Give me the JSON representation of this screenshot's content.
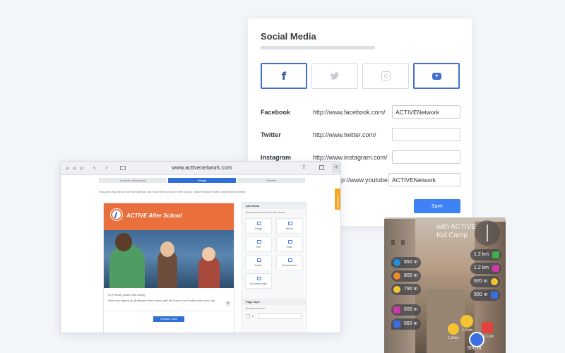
{
  "social": {
    "title": "Social Media",
    "rows": [
      {
        "label": "Facebook",
        "prefix": "http://www.facebook.com/",
        "value": "ACTIVENetwork"
      },
      {
        "label": "Twitter",
        "prefix": "http://www.twitter.com/",
        "value": ""
      },
      {
        "label": "Instagram",
        "prefix": "http://www.instagram.com/",
        "value": ""
      },
      {
        "label": "",
        "prefix": "http://www.youtube.com/",
        "value": "ACTIVENetwork"
      }
    ],
    "save_label": "Save",
    "tiles": [
      {
        "icon": "facebook-icon",
        "glyph": "f",
        "active": true
      },
      {
        "icon": "twitter-icon",
        "glyph": "🐦",
        "active": false
      },
      {
        "icon": "instagram-icon",
        "active": false
      },
      {
        "icon": "youtube-icon",
        "active": true
      }
    ],
    "colors": {
      "accent": "#3f6fd1",
      "save": "#3f82f6",
      "facebook": "#3b5998"
    }
  },
  "browser": {
    "url": "www.activenetwork.com",
    "nav_back": "‹",
    "nav_forward": "›",
    "share_glyph": "⇪",
    "plus_glyph": "+",
    "steps": [
      "Template Information",
      "Design",
      "Preview"
    ],
    "intro": "Drag and drop items from the sidebar and move them around in the layout. Switch between tabs to edit their contents.",
    "feedback_tab": "Feedback",
    "email": {
      "header_title": "ACTIVE After School",
      "body_line1": "Hi {Primary parent first name},",
      "body_line2": "Have you signed up {Participant first name} yet? Be sure to do it before time runs out!",
      "edit_glyph": "✎",
      "register_label": "Register Now"
    },
    "panel": {
      "add_items_title": "Add items",
      "add_items_hint": "Drag and drop items into the canvas",
      "items": [
        "Image",
        "Button",
        "Text",
        "Code",
        "Divider",
        "Social media",
        "Document links"
      ],
      "page_style_title": "Page style",
      "background_label": "Background color",
      "hash": "#"
    },
    "colors": {
      "step_active": "#2f6fd6",
      "header": "#e96f3c",
      "feedback": "#f5a623"
    }
  },
  "ar": {
    "title_line1": "with ACTIVE",
    "title_line2": "Kid Camp",
    "left_pills": [
      {
        "text": "850 m",
        "color": "#1f8fe0",
        "icon": "drop-icon"
      },
      {
        "text": "800 m",
        "color": "#f08a24",
        "icon": "pin-icon"
      },
      {
        "text": "790 m",
        "color": "#f5c531",
        "icon": "star-icon"
      },
      {
        "text": "600 m",
        "color": "#c93aa8",
        "icon": "camera-icon"
      },
      {
        "text": "560 m",
        "color": "#3b6ee0",
        "icon": "hiking-icon"
      }
    ],
    "right_pills": [
      {
        "text": "1.2 km",
        "color": "#3fae49",
        "icon": "leaf-icon"
      },
      {
        "text": "1.2 km",
        "color": "#c93aa8",
        "icon": "camera-icon"
      },
      {
        "text": "920 m",
        "color": "#f5c531",
        "icon": "star-icon"
      },
      {
        "text": "900 m",
        "color": "#3b6ee0",
        "icon": "hiking-icon"
      }
    ],
    "mini_distances": [
      "1.4 km",
      "1.3 km",
      "1.1 km"
    ],
    "bottom_distance": "500 m"
  }
}
